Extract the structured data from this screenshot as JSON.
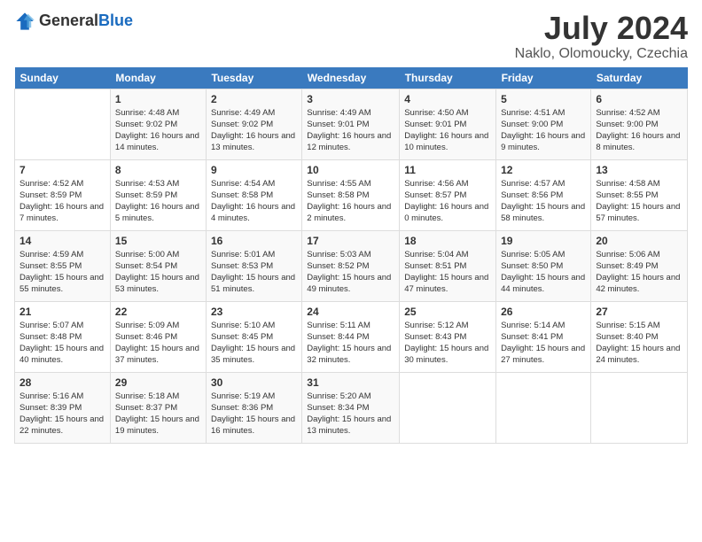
{
  "header": {
    "logo_general": "General",
    "logo_blue": "Blue",
    "title": "July 2024",
    "location": "Naklo, Olomoucky, Czechia"
  },
  "weekdays": [
    "Sunday",
    "Monday",
    "Tuesday",
    "Wednesday",
    "Thursday",
    "Friday",
    "Saturday"
  ],
  "weeks": [
    [
      {
        "day": "",
        "empty": true
      },
      {
        "day": "1",
        "sunrise": "4:48 AM",
        "sunset": "9:02 PM",
        "daylight": "16 hours and 14 minutes."
      },
      {
        "day": "2",
        "sunrise": "4:49 AM",
        "sunset": "9:02 PM",
        "daylight": "16 hours and 13 minutes."
      },
      {
        "day": "3",
        "sunrise": "4:49 AM",
        "sunset": "9:01 PM",
        "daylight": "16 hours and 12 minutes."
      },
      {
        "day": "4",
        "sunrise": "4:50 AM",
        "sunset": "9:01 PM",
        "daylight": "16 hours and 10 minutes."
      },
      {
        "day": "5",
        "sunrise": "4:51 AM",
        "sunset": "9:00 PM",
        "daylight": "16 hours and 9 minutes."
      },
      {
        "day": "6",
        "sunrise": "4:52 AM",
        "sunset": "9:00 PM",
        "daylight": "16 hours and 8 minutes."
      }
    ],
    [
      {
        "day": "7",
        "sunrise": "4:52 AM",
        "sunset": "8:59 PM",
        "daylight": "16 hours and 7 minutes."
      },
      {
        "day": "8",
        "sunrise": "4:53 AM",
        "sunset": "8:59 PM",
        "daylight": "16 hours and 5 minutes."
      },
      {
        "day": "9",
        "sunrise": "4:54 AM",
        "sunset": "8:58 PM",
        "daylight": "16 hours and 4 minutes."
      },
      {
        "day": "10",
        "sunrise": "4:55 AM",
        "sunset": "8:58 PM",
        "daylight": "16 hours and 2 minutes."
      },
      {
        "day": "11",
        "sunrise": "4:56 AM",
        "sunset": "8:57 PM",
        "daylight": "16 hours and 0 minutes."
      },
      {
        "day": "12",
        "sunrise": "4:57 AM",
        "sunset": "8:56 PM",
        "daylight": "15 hours and 58 minutes."
      },
      {
        "day": "13",
        "sunrise": "4:58 AM",
        "sunset": "8:55 PM",
        "daylight": "15 hours and 57 minutes."
      }
    ],
    [
      {
        "day": "14",
        "sunrise": "4:59 AM",
        "sunset": "8:55 PM",
        "daylight": "15 hours and 55 minutes."
      },
      {
        "day": "15",
        "sunrise": "5:00 AM",
        "sunset": "8:54 PM",
        "daylight": "15 hours and 53 minutes."
      },
      {
        "day": "16",
        "sunrise": "5:01 AM",
        "sunset": "8:53 PM",
        "daylight": "15 hours and 51 minutes."
      },
      {
        "day": "17",
        "sunrise": "5:03 AM",
        "sunset": "8:52 PM",
        "daylight": "15 hours and 49 minutes."
      },
      {
        "day": "18",
        "sunrise": "5:04 AM",
        "sunset": "8:51 PM",
        "daylight": "15 hours and 47 minutes."
      },
      {
        "day": "19",
        "sunrise": "5:05 AM",
        "sunset": "8:50 PM",
        "daylight": "15 hours and 44 minutes."
      },
      {
        "day": "20",
        "sunrise": "5:06 AM",
        "sunset": "8:49 PM",
        "daylight": "15 hours and 42 minutes."
      }
    ],
    [
      {
        "day": "21",
        "sunrise": "5:07 AM",
        "sunset": "8:48 PM",
        "daylight": "15 hours and 40 minutes."
      },
      {
        "day": "22",
        "sunrise": "5:09 AM",
        "sunset": "8:46 PM",
        "daylight": "15 hours and 37 minutes."
      },
      {
        "day": "23",
        "sunrise": "5:10 AM",
        "sunset": "8:45 PM",
        "daylight": "15 hours and 35 minutes."
      },
      {
        "day": "24",
        "sunrise": "5:11 AM",
        "sunset": "8:44 PM",
        "daylight": "15 hours and 32 minutes."
      },
      {
        "day": "25",
        "sunrise": "5:12 AM",
        "sunset": "8:43 PM",
        "daylight": "15 hours and 30 minutes."
      },
      {
        "day": "26",
        "sunrise": "5:14 AM",
        "sunset": "8:41 PM",
        "daylight": "15 hours and 27 minutes."
      },
      {
        "day": "27",
        "sunrise": "5:15 AM",
        "sunset": "8:40 PM",
        "daylight": "15 hours and 24 minutes."
      }
    ],
    [
      {
        "day": "28",
        "sunrise": "5:16 AM",
        "sunset": "8:39 PM",
        "daylight": "15 hours and 22 minutes."
      },
      {
        "day": "29",
        "sunrise": "5:18 AM",
        "sunset": "8:37 PM",
        "daylight": "15 hours and 19 minutes."
      },
      {
        "day": "30",
        "sunrise": "5:19 AM",
        "sunset": "8:36 PM",
        "daylight": "15 hours and 16 minutes."
      },
      {
        "day": "31",
        "sunrise": "5:20 AM",
        "sunset": "8:34 PM",
        "daylight": "15 hours and 13 minutes."
      },
      {
        "day": "",
        "empty": true
      },
      {
        "day": "",
        "empty": true
      },
      {
        "day": "",
        "empty": true
      }
    ]
  ]
}
